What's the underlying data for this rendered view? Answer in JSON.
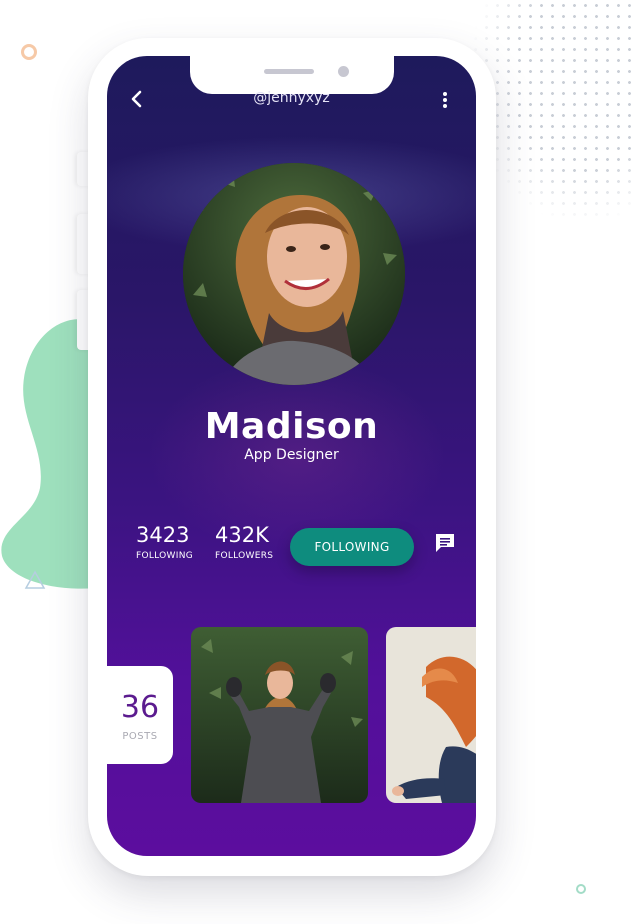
{
  "profile": {
    "handle": "@jennyxyz",
    "name": "Madison",
    "role": "App Designer"
  },
  "stats": {
    "following": {
      "value": "3423",
      "label": "FOLLOWING"
    },
    "followers": {
      "value": "432K",
      "label": "FOLLOWERS"
    }
  },
  "actions": {
    "follow_label": "FOLLOWING"
  },
  "posts": {
    "count": "36",
    "label": "POSTS"
  },
  "icons": {
    "back": "chevron-left-icon",
    "more": "more-vertical-icon",
    "message": "message-icon"
  },
  "colors": {
    "accent": "#0e8c7e",
    "posts_count": "#5b1b8f"
  }
}
